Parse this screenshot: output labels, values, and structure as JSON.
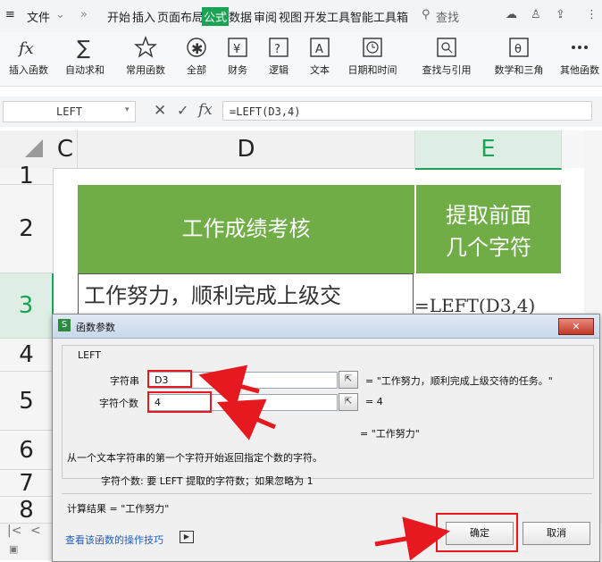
{
  "menubar": {
    "file": "文件",
    "tabs": [
      "开始",
      "插入",
      "页面布局",
      "公式",
      "数据",
      "审阅",
      "视图",
      "开发工具",
      "智能工具箱"
    ],
    "active_tab": "公式",
    "search": "查找"
  },
  "ribbon": {
    "buttons": [
      "插入函数",
      "自动求和",
      "常用函数",
      "全部",
      "财务",
      "逻辑",
      "文本",
      "日期和时间",
      "查找与引用",
      "数学和三角",
      "其他函数"
    ]
  },
  "formula_bar": {
    "cell_ref": "LEFT",
    "formula": "=LEFT(D3,4)",
    "fx": "fx"
  },
  "sheet": {
    "columns": [
      "C",
      "D",
      "E"
    ],
    "rows": [
      "1",
      "2",
      "3",
      "4",
      "5",
      "6",
      "7",
      "8"
    ],
    "header_d": "工作成绩考核",
    "header_e": "提取前面几个字符",
    "d3_text": "工作努力，顺利完成上级交",
    "e3_text": "=LEFT(D3,4)"
  },
  "dialog": {
    "title": "函数参数",
    "func_name": "LEFT",
    "arg1_label": "字符串",
    "arg1_value": "D3",
    "arg1_result": "= \"工作努力，顺利完成上级交待的任务。\"",
    "arg2_label": "字符个数",
    "arg2_value": "4",
    "arg2_result": "= 4",
    "total_result": "= \"工作努力\"",
    "description": "从一个文本字符串的第一个字符开始返回指定个数的字符。",
    "param_help": "字符个数:  要 LEFT 提取的字符数；如果忽略为 1",
    "calc_result": "计算结果 = \"工作努力\"",
    "help_link": "查看该函数的操作技巧",
    "ok": "确定",
    "cancel": "取消"
  },
  "colors": {
    "green_header": "#70ad47",
    "accent_green": "#1aa355",
    "highlight_red": "#e5191f"
  }
}
